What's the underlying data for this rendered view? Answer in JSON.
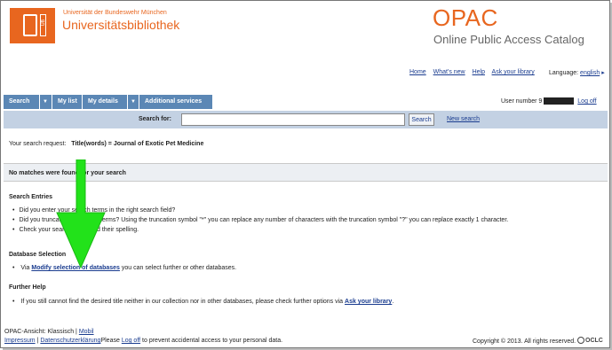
{
  "header": {
    "logo_mark": "UB",
    "university": "Universität der Bundeswehr München",
    "library": "Universitätsbibliothek",
    "app_title": "OPAC",
    "app_subtitle": "Online Public Access Catalog"
  },
  "toplinks": [
    "Home",
    "What's new",
    "Help",
    "Ask your library"
  ],
  "language": {
    "label": "Language:",
    "value": "english"
  },
  "nav": {
    "tabs": [
      "Search",
      "My list",
      "My details",
      "Additional services"
    ],
    "caret": "▼"
  },
  "user": {
    "label": "User number",
    "prefix": "9",
    "logoff": "Log off"
  },
  "search": {
    "label": "Search for:",
    "value": "",
    "button": "Search",
    "new_search": "New search"
  },
  "request": {
    "label": "Your search request:",
    "query": "Title(words) = Journal of Exotic Pet Medicine"
  },
  "no_matches": "No matches were found for your search",
  "search_entries": {
    "title": "Search Entries",
    "items": [
      "Did you enter your search terms in the right search field?",
      "Did you truncate your search terms? Using the truncation symbol \"*\" you can replace any number of characters with the truncation symbol \"?\" you can replace exactly 1 character.",
      "Check your search terms and their spelling."
    ]
  },
  "database_selection": {
    "title": "Database Selection",
    "pre": "Via",
    "link": "Modify selection of databases",
    "post": "you can select further or other databases."
  },
  "further_help": {
    "title": "Further Help",
    "pre": "If you still cannot find the desired title neither in our collection nor in other databases, please check further options via",
    "link": "Ask your library",
    "post": "."
  },
  "footer": {
    "view_label": "OPAC-Ansicht:",
    "classic": "Klassisch",
    "sep": "|",
    "mobile": "Mobil",
    "impressum": "Impressum",
    "privacy": "Datenschutzerklärung",
    "please": "Please",
    "logoff": "Log off",
    "logoff_post": "to prevent accidental access to your personal data.",
    "copyright": "Copyright © 2013. All rights reserved.",
    "oclc": "OCLC"
  },
  "colors": {
    "accent": "#e8661f",
    "nav": "#5b87b5",
    "searchbar": "#c3d1e3",
    "arrow": "#22e21a",
    "link": "#1a3c8f"
  }
}
